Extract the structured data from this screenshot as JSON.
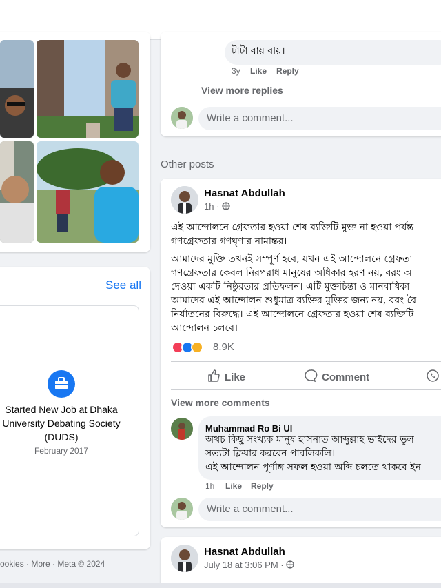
{
  "top_comment": {
    "text": "টাটা বায় বায়।",
    "time": "3y",
    "like": "Like",
    "reply": "Reply"
  },
  "view_more_replies": "View more replies",
  "write_comment_placeholder": "Write a comment...",
  "other_posts_title": "Other posts",
  "see_all": "See all",
  "life_event": {
    "line1": "Started New Job at Dhaka",
    "line2": "University Debating Society",
    "line3": "(DUDS)",
    "date": "February 2017"
  },
  "footer_links": "ookies · More · Meta © 2024",
  "post1": {
    "author": "Hasnat Abdullah",
    "time": "1h ·",
    "para1": [
      "এই আন্দোলনে গ্রেফতার হওয়া শেষ ব্যক্তিটি মুক্ত না হওয়া পর্যন্ত",
      "গণগ্রেফতার গণঘৃণার নামান্তর।"
    ],
    "para2": [
      "আমাদের মুক্তি তখনই সম্পূর্ণ হবে, যখন এই আন্দোলনে গ্রেফতা",
      "গণগ্রেফতার কেবল নিরপরাধ মানুষের অধিকার হরণ নয়, বরং অ",
      "দেওয়া একটি নিষ্ঠুরতার প্রতিফলন। এটি মুক্তচিন্তা ও মানবাধিকা",
      "আমাদের এই আন্দোলন শুধুমাত্র ব্যক্তির মুক্তির জন্য নয়, বরং বৈ",
      "নির্যাতনের বিরুদ্ধে। এই আন্দোলনে গ্রেফতার হওয়া শেষ ব্যক্তিটি",
      "আন্দোলন চলবে।"
    ],
    "reaction_count": "8.9K",
    "actions": {
      "like": "Like",
      "comment": "Comment"
    },
    "view_more_comments": "View more comments",
    "comment": {
      "name": "Muhammad Ro Bi Ul",
      "lines": [
        "অথচ কিছু সংখ্যক মানুষ হাসনাত আব্দুল্লাহ ভাইদের ভুল",
        "সত্যটা ক্লিয়ার করবেন পাবলিকলি।",
        "এই আন্দোলন পূর্ণাঙ্গ সফল হওয়া অব্দি চলতে থাকবে ইন"
      ],
      "time": "1h",
      "like": "Like",
      "reply": "Reply"
    }
  },
  "post2": {
    "author": "Hasnat Abdullah",
    "time": "July 18 at 3:06 PM ·"
  },
  "colors": {
    "accent": "#1877f2",
    "secondary_text": "#65676b",
    "background": "#f0f2f5"
  },
  "icons": [
    "globe-icon",
    "like-thumb-icon",
    "comment-bubble-icon",
    "whatsapp-icon",
    "briefcase-icon",
    "love-reaction-icon",
    "like-reaction-icon",
    "care-reaction-icon"
  ]
}
